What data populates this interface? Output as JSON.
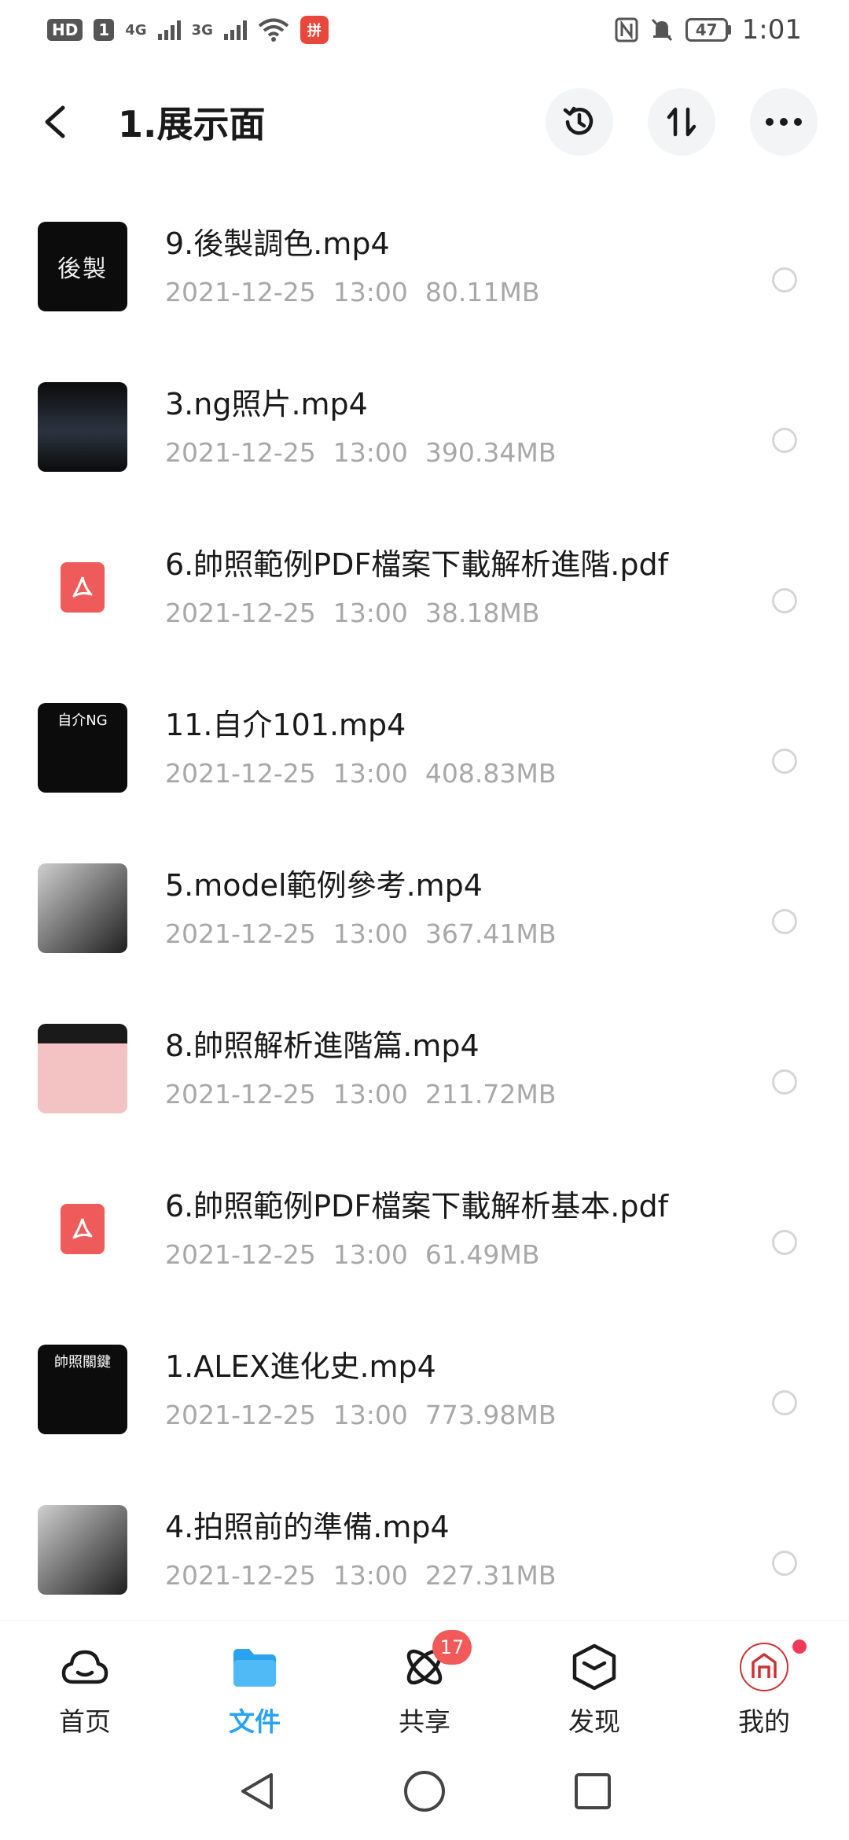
{
  "status_bar": {
    "hd": "HD",
    "sim": "1",
    "net1": "4G",
    "net2": "3G",
    "app_badge": "拼",
    "battery": "47",
    "time": "1:01"
  },
  "header": {
    "title": "1.展示面",
    "icons": [
      "history-icon",
      "sort-icon",
      "more-icon"
    ]
  },
  "files": [
    {
      "name": "9.後製調色.mp4",
      "date": "2021-12-25",
      "time": "13:00",
      "size": "80.11MB",
      "thumb": "後製"
    },
    {
      "name": "3.ng照片.mp4",
      "date": "2021-12-25",
      "time": "13:00",
      "size": "390.34MB",
      "thumb": ""
    },
    {
      "name": "6.帥照範例PDF檔案下載解析進階.pdf",
      "date": "2021-12-25",
      "time": "13:00",
      "size": "38.18MB",
      "thumb": ""
    },
    {
      "name": "11.自介101.mp4",
      "date": "2021-12-25",
      "time": "13:00",
      "size": "408.83MB",
      "thumb": "自介NG"
    },
    {
      "name": "5.model範例參考.mp4",
      "date": "2021-12-25",
      "time": "13:00",
      "size": "367.41MB",
      "thumb": ""
    },
    {
      "name": "8.帥照解析進階篇.mp4",
      "date": "2021-12-25",
      "time": "13:00",
      "size": "211.72MB",
      "thumb": ""
    },
    {
      "name": "6.帥照範例PDF檔案下載解析基本.pdf",
      "date": "2021-12-25",
      "time": "13:00",
      "size": "61.49MB",
      "thumb": ""
    },
    {
      "name": "1.ALEX進化史.mp4",
      "date": "2021-12-25",
      "time": "13:00",
      "size": "773.98MB",
      "thumb": "帥照關鍵"
    },
    {
      "name": "4.拍照前的準備.mp4",
      "date": "2021-12-25",
      "time": "13:00",
      "size": "227.31MB",
      "thumb": ""
    }
  ],
  "nav": {
    "home": "首页",
    "files": "文件",
    "share": "共享",
    "share_badge": "17",
    "discover": "发现",
    "mine": "我的"
  },
  "colors": {
    "accent": "#2aa3ef",
    "badge": "#f25a5a",
    "pdf": "#ef5b5b",
    "meta_text": "#a8a8a8"
  }
}
